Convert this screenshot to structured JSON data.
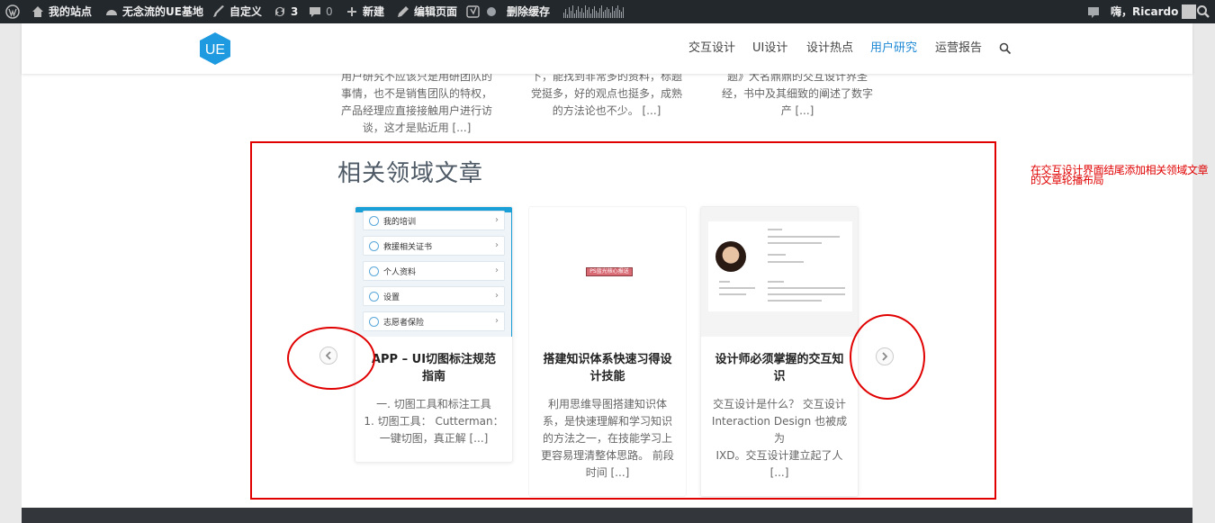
{
  "adminbar": {
    "site_name": "我的站点",
    "site_link": "无念流的UE基地",
    "customize": "自定义",
    "updates_count": "3",
    "comments_count": "0",
    "new": "新建",
    "edit_page": "编辑页面",
    "clear_cache": "删除缓存",
    "greeting": "嗨，Ricardo"
  },
  "header": {
    "logo_text": "UE",
    "nav": [
      "交互设计",
      "UI设计",
      "设计热点",
      "用户研究",
      "运营报告"
    ],
    "active_nav": "用户研究"
  },
  "previous_excerpts": [
    [
      "用户研究不应该只是用研团队的",
      "事情，也不是销售团队的特权，",
      "产品经理应直接接触用户进行访",
      "谈，这才是贴近用 [...]"
    ],
    [
      "下，能找到非常多的资料，标题",
      "党挺多，好的观点也挺多，成熟",
      "的方法论也不少。 [...]"
    ],
    [
      "题》大名鼎鼎的交互设计界圣",
      "经，书中及其细致的阐述了数字",
      "产 [...]"
    ]
  ],
  "related": {
    "title": "相关领域文章",
    "cards": [
      {
        "title_lines": [
          "APP – UI切图标注规范",
          "指南"
        ],
        "excerpt_lines": [
          "一. 切图工具和标注工具",
          "1. 切图工具： Cutterman：",
          "一键切图，真正解 [...]"
        ],
        "thumb_rows": [
          "我的培训",
          "救援相关证书",
          "个人资料",
          "设置",
          "志愿者保险"
        ]
      },
      {
        "title_lines": [
          "搭建知识体系快速习得设",
          "计技能"
        ],
        "excerpt_lines": [
          "利用思维导图搭建知识体",
          "系，是快速理解和学习知识",
          "的方法之一，在技能学习上",
          "更容易理清整体思路。 前段",
          "时间 [...]"
        ],
        "thumb_badge": "PS蓝光核心报送"
      },
      {
        "title_lines": [
          "设计师必须掌握的交互知",
          "识"
        ],
        "excerpt_lines": [
          "交互设计是什么？ 交互设计",
          "Interaction Design 也被成为",
          "IXD。交互设计建立起了人",
          "[...]"
        ]
      }
    ]
  },
  "annotation": {
    "note_lines": [
      "在交互设计界面结尾添加相关领域文章",
      "的文章轮播布局"
    ],
    "color": "#e00000"
  },
  "colors": {
    "accent": "#1e88d6",
    "adminbar": "#23282d",
    "annotation": "#e00000"
  }
}
